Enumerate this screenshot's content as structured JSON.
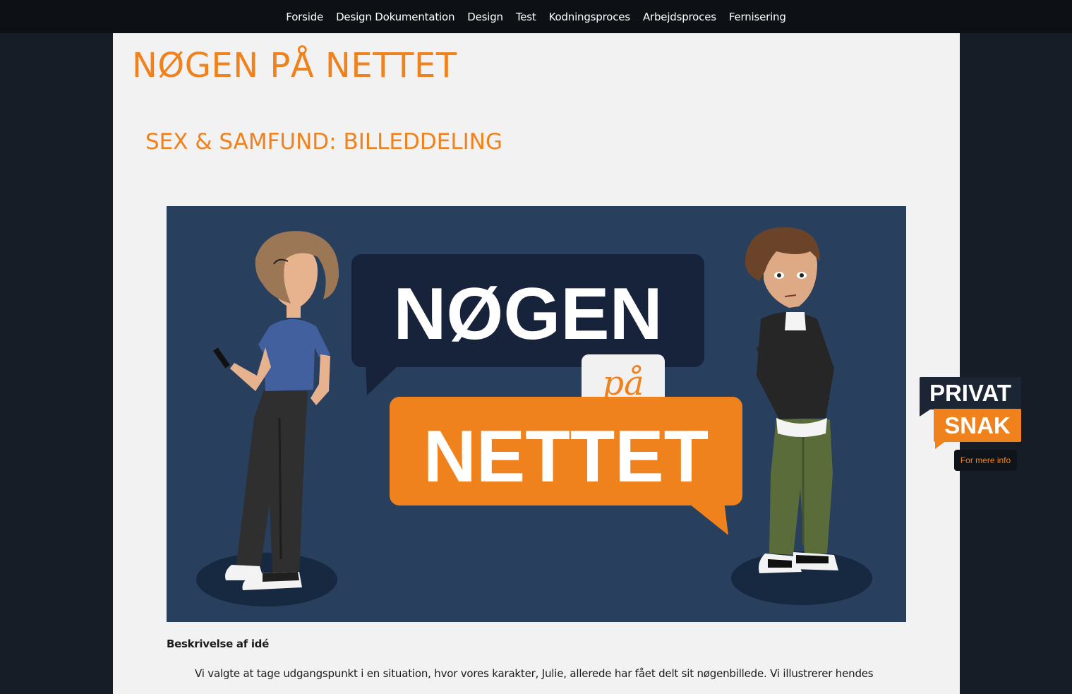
{
  "nav": {
    "items": [
      {
        "label": "Forside"
      },
      {
        "label": "Design Dokumentation"
      },
      {
        "label": "Design"
      },
      {
        "label": "Test"
      },
      {
        "label": "Kodningsproces"
      },
      {
        "label": "Arbejdsproces"
      },
      {
        "label": "Fernisering"
      }
    ]
  },
  "site": {
    "title": "NØGEN PÅ NETTET"
  },
  "section": {
    "title": "SEX & SAMFUND: BILLEDDELING"
  },
  "hero": {
    "logo_top": "NØGEN",
    "logo_mid": "på",
    "logo_bottom": "NETTET"
  },
  "description": {
    "heading": "Beskrivelse af idé",
    "text": "Vi valgte at tage udgangspunkt i en situation, hvor vores karakter, Julie, allerede har fået delt sit nøgenbillede. Vi illustrerer hendes"
  },
  "widget": {
    "line1": "PRIVAT",
    "line2": "SNAK",
    "info": "For mere info"
  },
  "colors": {
    "accent": "#f0821e",
    "dark_bg": "#161d26",
    "nav_bg": "#0d1116",
    "page_bg": "#f2f2f2",
    "hero_bg": "#283f5e"
  }
}
